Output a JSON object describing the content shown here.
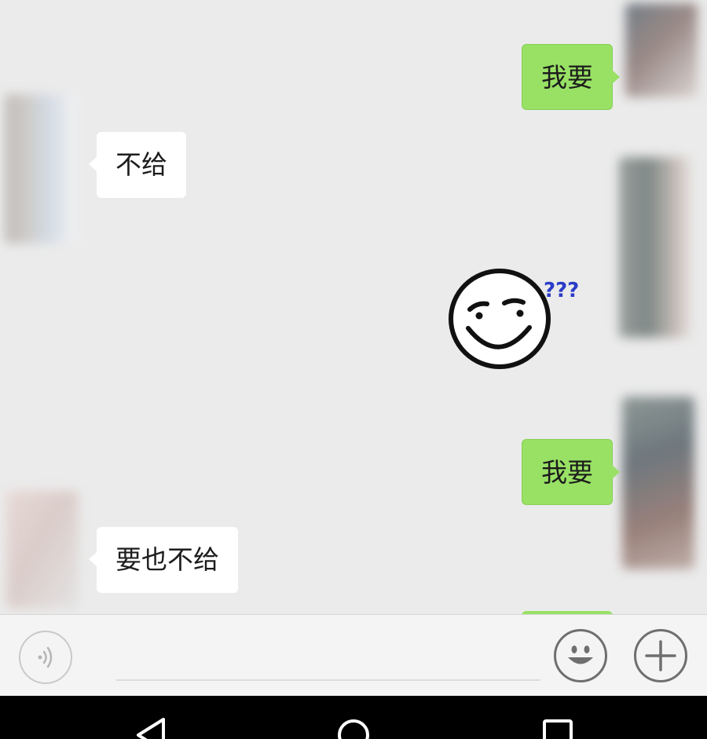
{
  "messages": [
    {
      "side": "right",
      "text": "我要"
    },
    {
      "side": "left",
      "text": "不给"
    },
    {
      "side": "right",
      "type": "sticker",
      "sticker": {
        "icon": "smirk-face-sticker",
        "caption": "???"
      }
    },
    {
      "side": "right",
      "text": "我要"
    },
    {
      "side": "left",
      "text": "要也不给"
    }
  ],
  "input_bar": {
    "voice_icon": "voice-icon",
    "message_value": "",
    "emoji_icon": "smiley-icon",
    "more_icon": "plus-icon"
  },
  "nav_bar": {
    "back_icon": "back-triangle-icon",
    "home_icon": "home-circle-icon",
    "recents_icon": "recents-square-icon"
  },
  "colors": {
    "chat_background": "#ebebeb",
    "my_bubble": "#98e165",
    "their_bubble": "#ffffff",
    "sticker_question_marks": "#2b3cc8",
    "nav_bar": "#000000"
  }
}
